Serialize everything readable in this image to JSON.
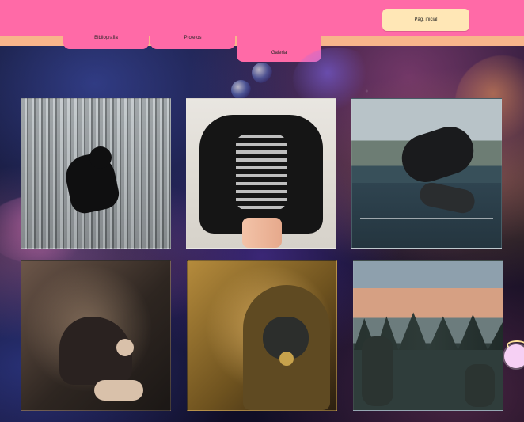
{
  "nav": {
    "tabs": [
      {
        "label": "Bibliografia"
      },
      {
        "label": "Projetos"
      },
      {
        "label": "Galeria"
      }
    ],
    "home_button": "Pág. inicial"
  },
  "colors": {
    "topbar": "#ff6aa7",
    "underline": "#f8b58b",
    "home_button": "#ffe7b6"
  },
  "gallery": {
    "images": [
      {
        "name": "image-climbing"
      },
      {
        "name": "image-skeleton-hoodie"
      },
      {
        "name": "image-motorcycle"
      },
      {
        "name": "image-family"
      },
      {
        "name": "image-gas-mask"
      },
      {
        "name": "image-soldiers"
      }
    ]
  }
}
